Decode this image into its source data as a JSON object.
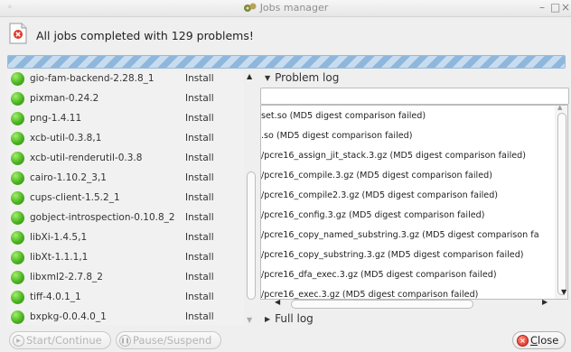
{
  "window": {
    "title": "Jobs manager",
    "controls": {
      "minimize": "–",
      "maximize": "□",
      "close": "×"
    }
  },
  "status": {
    "icon": "error-document-icon",
    "message": "All jobs completed with 129 problems!"
  },
  "progress": {
    "fraction": 1.0
  },
  "packages": [
    {
      "name": "gio-fam-backend-2.28.8_1",
      "action": "Install"
    },
    {
      "name": "pixman-0.24.2",
      "action": "Install"
    },
    {
      "name": "png-1.4.11",
      "action": "Install"
    },
    {
      "name": "xcb-util-0.3.8,1",
      "action": "Install"
    },
    {
      "name": "xcb-util-renderutil-0.3.8",
      "action": "Install"
    },
    {
      "name": "cairo-1.10.2_3,1",
      "action": "Install"
    },
    {
      "name": "cups-client-1.5.2_1",
      "action": "Install"
    },
    {
      "name": "gobject-introspection-0.10.8_2",
      "action": "Install"
    },
    {
      "name": "libXi-1.4.5,1",
      "action": "Install"
    },
    {
      "name": "libXt-1.1.1,1",
      "action": "Install"
    },
    {
      "name": "libxml2-2.7.8_2",
      "action": "Install"
    },
    {
      "name": "tiff-4.0.1_1",
      "action": "Install"
    },
    {
      "name": "bxpkg-0.0.4.0_1",
      "action": "Install"
    }
  ],
  "problem_log": {
    "label": "Problem log",
    "lines": [
      "set.so (MD5 digest comparison failed)",
      ".so (MD5 digest comparison failed)",
      "/pcre16_assign_jit_stack.3.gz (MD5 digest comparison failed)",
      "/pcre16_compile.3.gz (MD5 digest comparison failed)",
      "/pcre16_compile2.3.gz (MD5 digest comparison failed)",
      "/pcre16_config.3.gz (MD5 digest comparison failed)",
      "/pcre16_copy_named_substring.3.gz (MD5 digest comparison fa",
      "/pcre16_copy_substring.3.gz (MD5 digest comparison failed)",
      "/pcre16_dfa_exec.3.gz (MD5 digest comparison failed)",
      "/pcre16_exec.3.gz (MD5 digest comparison failed)"
    ]
  },
  "full_log": {
    "label": "Full log"
  },
  "buttons": {
    "start": "Start/Continue",
    "pause": "Pause/Suspend",
    "close": "Close"
  }
}
